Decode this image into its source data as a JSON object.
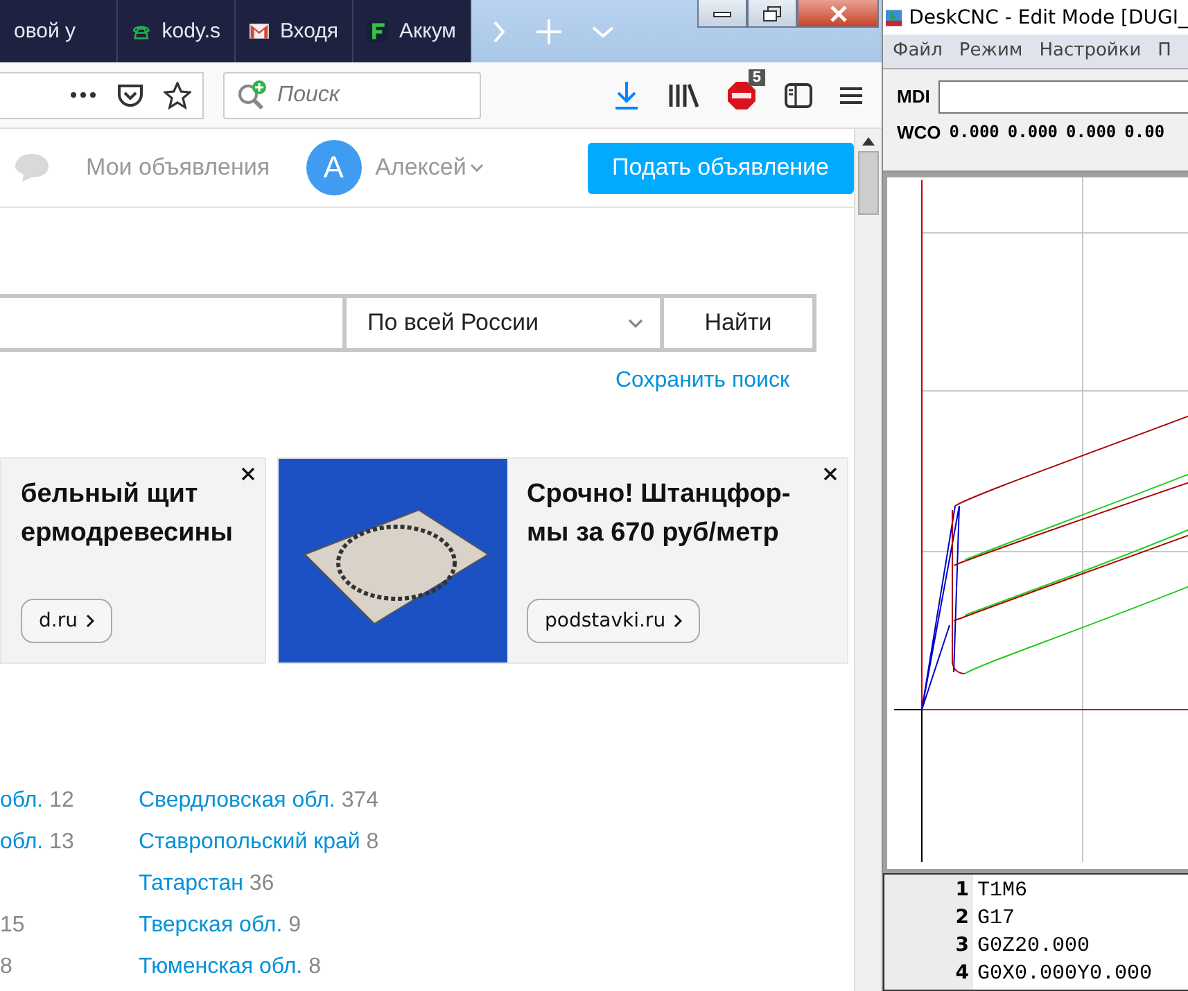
{
  "browser": {
    "tabs": [
      {
        "title": "овой у",
        "kind": "plain"
      },
      {
        "title": "kody.s",
        "kind": "phone"
      },
      {
        "title": "Входя",
        "kind": "mail"
      },
      {
        "title": "Аккум",
        "kind": "letter"
      }
    ],
    "search": {
      "placeholder": "Поиск"
    },
    "adblock_count": "5"
  },
  "page": {
    "header": {
      "my_ads": "Мои объявления",
      "avatar": "А",
      "user": "Алексей",
      "post_button": "Подать объявление"
    },
    "search": {
      "region": "По всей России",
      "button": "Найти",
      "save_link": "Сохранить поиск"
    },
    "ads": [
      {
        "kind": "text",
        "headline": [
          "бельный щит",
          "ермодревесины"
        ],
        "link": "d.ru"
      },
      {
        "kind": "image",
        "headline": [
          "Срочно! Штанцфор-",
          "мы за 670 руб/метр"
        ],
        "link": "podstavki.ru"
      }
    ],
    "regions": [
      {
        "left": {
          "name": "обл.",
          "count": "12"
        },
        "right": {
          "name": "Свердловская обл.",
          "count": "374"
        }
      },
      {
        "left": {
          "name": "обл.",
          "count": "13"
        },
        "right": {
          "name": "Ставропольский край",
          "count": "8"
        }
      },
      {
        "right": {
          "name": "Татарстан",
          "count": "36"
        }
      },
      {
        "left": {
          "count": "15"
        },
        "right": {
          "name": "Тверская обл.",
          "count": "9"
        }
      },
      {
        "left": {
          "count": "8"
        },
        "right": {
          "name": "Тюменская обл.",
          "count": "8"
        }
      }
    ]
  },
  "cnc": {
    "title": "DeskCNC - Edit Mode [DUGI_",
    "menu": [
      "Файл",
      "Режим",
      "Настройки",
      "П"
    ],
    "mdi_label": "MDI",
    "wco_label": "WCO",
    "wco_values": [
      "0.000",
      "0.000",
      "0.000",
      "0.00"
    ],
    "code": [
      {
        "number": "1",
        "text": "T1M6"
      },
      {
        "number": "2",
        "text": "G17"
      },
      {
        "number": "3",
        "text": "G0Z20.000"
      },
      {
        "number": "4",
        "text": "G0X0.000Y0.000"
      }
    ]
  }
}
